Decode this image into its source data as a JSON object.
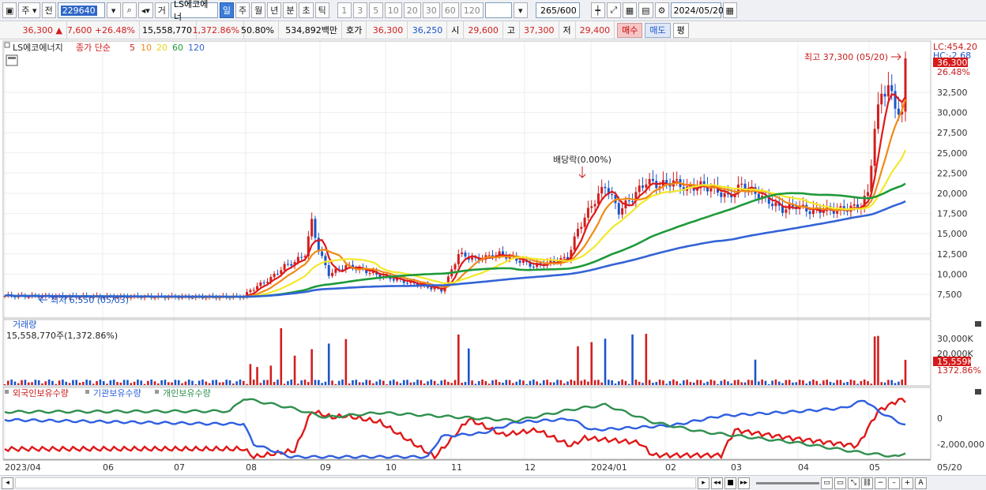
{
  "toolbar": {
    "period_label": "주",
    "prev_label": "전",
    "stock_code": "229640",
    "mode_label": "거",
    "stock_name": "LS에코에너",
    "tabs": [
      {
        "label": "일",
        "selected": true
      },
      {
        "label": "주",
        "selected": false
      },
      {
        "label": "월",
        "selected": false
      },
      {
        "label": "년",
        "selected": false
      },
      {
        "label": "분",
        "selected": false
      },
      {
        "label": "초",
        "selected": false
      },
      {
        "label": "틱",
        "selected": false
      }
    ],
    "intervals": [
      "1",
      "3",
      "5",
      "10",
      "20",
      "30",
      "60",
      "120"
    ],
    "count": "265",
    "count_total": "/600",
    "date": "2024/05/20"
  },
  "quote": {
    "price": "36,300",
    "arrow": "▲",
    "change": "7,600",
    "change_pct": "+26.48%",
    "volume": "15,558,770",
    "volume_pct": "1,372.86%",
    "turnover_rate": "50.80%",
    "amount": "534,892백만",
    "hoga_label": "호가",
    "ask": "36,300",
    "bid": "36,250",
    "open_label": "시",
    "open": "29,600",
    "high_label": "고",
    "high": "37,300",
    "low_label": "저",
    "low": "29,400",
    "buy_label": "매수",
    "sell_label": "매도",
    "eq_label": "평"
  },
  "legend": {
    "name": "LS에코에너지",
    "main": "종가 단순",
    "ma": [
      "5",
      "10",
      "20",
      "60",
      "120"
    ]
  },
  "price_panel": {
    "lc_label": "LC:454.20",
    "hc_label": "HC:-2.68",
    "current_tag": "36,300",
    "pct_tag": "26.48%",
    "y_ticks": [
      "32,500",
      "30,000",
      "27,500",
      "25,000",
      "22,500",
      "20,000",
      "17,500",
      "15,000",
      "12,500",
      "10,000",
      "7,500"
    ],
    "max_note": "최고 37,300 (05/20)",
    "min_note": "최저 6,550 (05/03)",
    "dividend_note": "배당락(0.00%)"
  },
  "volume_panel": {
    "title": "거래량",
    "value": "15,558,770주(1,372.86%)",
    "y_ticks": [
      "30,000K",
      "20,000K"
    ],
    "current_tag": "15,559K",
    "pct_tag": "1372.86%"
  },
  "holding_panel": {
    "legend": [
      "외국인보유수량",
      "기관보유수량",
      "개인보유수량"
    ],
    "y_ticks": [
      "0",
      "-2,000,000"
    ]
  },
  "x_axis": [
    "2023/04",
    "06",
    "07",
    "08",
    "09",
    "10",
    "11",
    "12",
    "2024/01",
    "02",
    "03",
    "04",
    "05",
    "05/20"
  ],
  "colors": {
    "up": "#d21e1e",
    "down": "#1b55c9",
    "ma5": "#e01818",
    "ma10": "#f08a14",
    "ma20": "#f3e82a",
    "ma60": "#1e9a3a",
    "ma120": "#3363d6",
    "foreign": "#e01818",
    "institution": "#2f5fe0",
    "individual": "#2f8f4e"
  }
}
